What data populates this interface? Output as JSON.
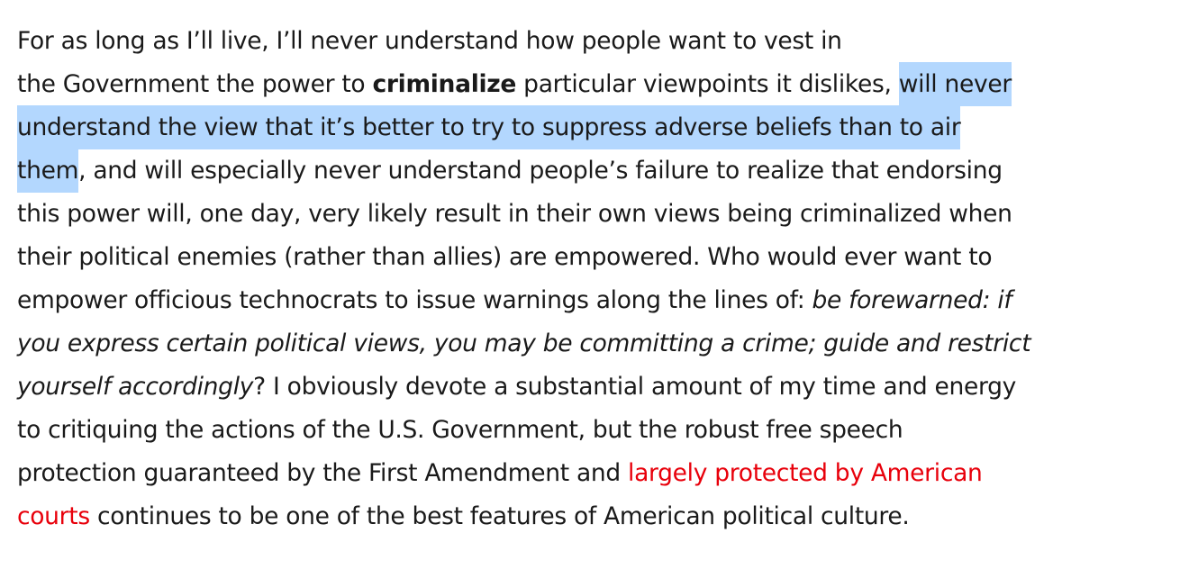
{
  "paragraph": {
    "l1": "For as long as I’ll live, I’ll never understand how people want to vest in",
    "l2a": "the Government the power to ",
    "l2b": "criminalize",
    "l2c": " particular viewpoints it dislikes, ",
    "l2d": "will never",
    "l3": "understand the view that it’s better to try to suppress adverse beliefs than to air",
    "l4a": "them",
    "l4b": ", and will especially never understand people’s failure to realize that endorsing",
    "l5": "this power will, one day, very likely result in their own views being criminalized when",
    "l6": "their political enemies (rather than allies) are empowered.  Who would ever want to",
    "l7a": "empower officious technocrats to issue warnings along the lines of:  ",
    "l7b": "be forewarned:  if",
    "l8": "you express certain political views, you may be committing a crime; guide and restrict",
    "l9a": "yourself accordingly",
    "l9b": "?  I obviously devote a substantial amount of my time and energy",
    "l10": "to critiquing the actions of the U.S. Government, but the robust free speech",
    "l11a": "protection guaranteed by the First Amendment and ",
    "l11b": "largely protected by American",
    "l12a": "courts",
    "l12b": " continues to be one of the best features of American political culture."
  },
  "colors": {
    "text": "#1a1a1a",
    "link": "#e8000b",
    "selection": "#b3d7fe"
  }
}
